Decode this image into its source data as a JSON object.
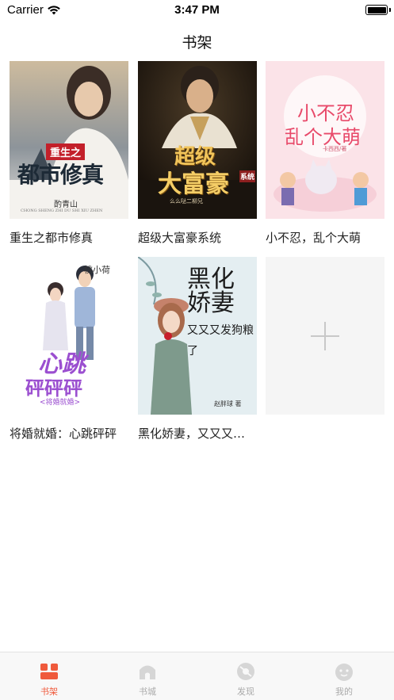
{
  "status_bar": {
    "carrier": "Carrier",
    "time": "3:47 PM",
    "wifi_icon": "wifi-icon",
    "battery_icon": "battery-icon"
  },
  "nav": {
    "title": "书架"
  },
  "books": [
    {
      "title": "重生之都市修真",
      "cover": {
        "top_text": "重生之",
        "main_text": "都市修真",
        "author": "酌青山",
        "subtitle": "CHONG SHENG ZHI DU SHI XIU ZHEN",
        "colors": [
          "#c9b79a",
          "#7f8a95",
          "#3a3f4a"
        ]
      }
    },
    {
      "title": "超级大富豪系统",
      "cover": {
        "main_text": "超级",
        "main_text_2": "大富豪",
        "badge": "系统",
        "author": "么么哒二柳兄",
        "colors": [
          "#2a2219",
          "#e0b34c",
          "#6b5638"
        ]
      }
    },
    {
      "title": "小不忍，乱个大萌",
      "cover": {
        "main_text": "小不忍",
        "main_text_2": "乱个大萌",
        "author": "卡西西/著",
        "colors": [
          "#fbe1e6",
          "#e84a6a",
          "#f7c9d3"
        ]
      }
    },
    {
      "title": "将婚就婚：心跳砰砰",
      "cover": {
        "author": "桃小荷",
        "main_text": "心跳",
        "main_text_2": "砰砰砰",
        "subtitle": "<将婚就婚>",
        "colors": [
          "#ffffff",
          "#9b4fd0",
          "#d8c3ef"
        ]
      }
    },
    {
      "title": "黑化娇妻，又又又发狗粮了",
      "cover": {
        "main_text": "黑化娇妻",
        "main_text_2": "又又又发狗粮了",
        "author": "赵胖球 著",
        "colors": [
          "#e8f0f3",
          "#1c1c1c",
          "#8aa1a8"
        ]
      }
    }
  ],
  "add_book_icon": "plus-icon",
  "tabs": [
    {
      "label": "书架",
      "icon": "bookshelf-icon",
      "active": true
    },
    {
      "label": "书城",
      "icon": "bookstore-icon",
      "active": false
    },
    {
      "label": "发现",
      "icon": "discover-icon",
      "active": false
    },
    {
      "label": "我的",
      "icon": "profile-icon",
      "active": false
    }
  ],
  "colors": {
    "accent": "#ef5a3c",
    "inactive": "#cfcfcf",
    "add_card_bg": "#f5f5f5"
  }
}
